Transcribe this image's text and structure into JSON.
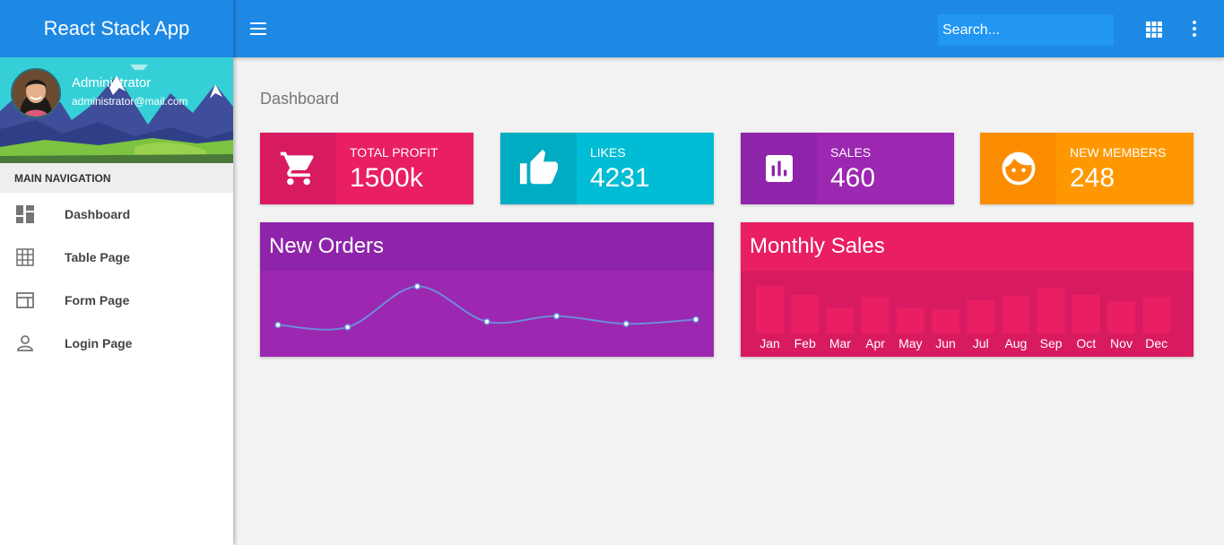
{
  "app": {
    "title": "React Stack App"
  },
  "user": {
    "name": "Administrator",
    "email": "administrator@mail.com"
  },
  "nav": {
    "header": "MAIN NAVIGATION",
    "items": [
      {
        "label": "Dashboard",
        "icon": "dashboard-icon"
      },
      {
        "label": "Table Page",
        "icon": "grid-icon"
      },
      {
        "label": "Form Page",
        "icon": "web-form-icon"
      },
      {
        "label": "Login Page",
        "icon": "person-icon"
      }
    ]
  },
  "topbar": {
    "search_placeholder": "Search...",
    "menu_icon": "hamburger-menu-icon",
    "apps_icon": "apps-grid-icon",
    "more_icon": "more-vertical-icon"
  },
  "page": {
    "title": "Dashboard"
  },
  "cards": [
    {
      "title": "TOTAL PROFIT",
      "value": "1500k",
      "icon": "shopping-cart-icon",
      "color": "#e91e63",
      "icon_bg": "#d81b60"
    },
    {
      "title": "LIKES",
      "value": "4231",
      "icon": "thumbs-up-icon",
      "color": "#00bcd4",
      "icon_bg": "#00acc1"
    },
    {
      "title": "SALES",
      "value": "460",
      "icon": "bar-chart-icon",
      "color": "#9c27b0",
      "icon_bg": "#8e24aa"
    },
    {
      "title": "NEW MEMBERS",
      "value": "248",
      "icon": "face-icon",
      "color": "#ff9800",
      "icon_bg": "#fb8c00"
    }
  ],
  "new_orders": {
    "title": "New Orders",
    "color": "#9c27b0",
    "header_color": "#8e24aa"
  },
  "monthly_sales": {
    "title": "Monthly Sales",
    "color": "#d81b60",
    "header_color": "#e91e63",
    "bar_color": "#e91e63"
  },
  "chart_data": [
    {
      "type": "line",
      "x": [
        1,
        2,
        3,
        4,
        5,
        6,
        7
      ],
      "series": [
        {
          "values": [
            24,
            22,
            59,
            27,
            32,
            25,
            29
          ]
        }
      ],
      "ylim": [
        0,
        70
      ]
    },
    {
      "type": "bar",
      "categories": [
        "Jan",
        "Feb",
        "Mar",
        "Apr",
        "May",
        "Jun",
        "Jul",
        "Aug",
        "Sep",
        "Oct",
        "Nov",
        "Dec"
      ],
      "series": [
        {
          "values": [
            44,
            36,
            24,
            34,
            24,
            22,
            31,
            35,
            42,
            36,
            30,
            34
          ]
        }
      ],
      "ylim": [
        0,
        50
      ]
    }
  ]
}
